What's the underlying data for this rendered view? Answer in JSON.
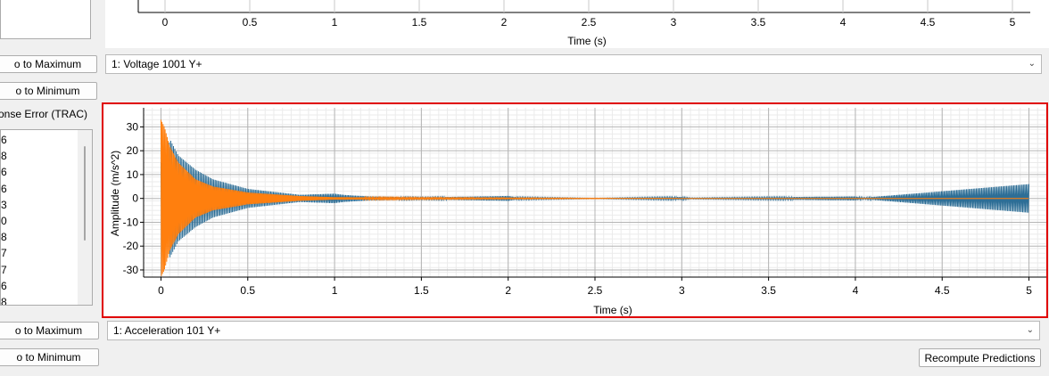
{
  "top_plot": {
    "xlabel": "Time (s)",
    "xticks": [
      "0",
      "0.5",
      "1",
      "1.5",
      "2",
      "2.5",
      "3",
      "3.5",
      "4",
      "4.5",
      "5"
    ]
  },
  "left_panel": {
    "go_max_1": "o to Maximum",
    "go_min_1": "o to Minimum",
    "response_error_label": "onse Error (TRAC)",
    "list_values": [
      "6",
      "8",
      "6",
      "6",
      "3",
      "0",
      "8",
      "7",
      "7",
      "6",
      "8"
    ],
    "go_max_2": "o to Maximum",
    "go_min_2": "o to Minimum"
  },
  "selectors": {
    "voltage": "1: Voltage 1001 Y+",
    "acceleration": "1: Acceleration 101 Y+"
  },
  "recompute_button": "Recompute Predictions",
  "chart_data": {
    "type": "line",
    "title": "",
    "xlabel": "Time (s)",
    "ylabel": "Amplitude (m/s^2)",
    "xlim": [
      -0.1,
      5.1
    ],
    "ylim": [
      -33,
      38
    ],
    "xticks": [
      0,
      0.5,
      1,
      1.5,
      2,
      2.5,
      3,
      3.5,
      4,
      4.5,
      5
    ],
    "xtick_labels": [
      "0",
      "0.5",
      "1",
      "1.5",
      "2",
      "2.5",
      "3",
      "3.5",
      "4",
      "4.5",
      "5"
    ],
    "yticks": [
      -30,
      -20,
      -10,
      0,
      10,
      20,
      30
    ],
    "ytick_labels": [
      "-30",
      "-20",
      "-10",
      "0",
      "10",
      "20",
      "30"
    ],
    "grid": true,
    "colors": {
      "measured": "#2d6e96",
      "predicted": "#ff7f0e",
      "highlight_border": "#e00000"
    },
    "series": [
      {
        "values_note": "measured",
        "x": [
          0,
          0.05,
          0.1,
          0.2,
          0.3,
          0.5,
          0.8,
          1.0,
          1.05,
          1.2,
          1.5,
          2.0,
          2.05,
          2.5,
          3.0,
          3.05,
          4.0,
          4.05,
          5.0
        ],
        "y": [
          -15,
          25,
          18,
          12,
          8,
          4,
          1.5,
          2,
          1.5,
          0.8,
          0.4,
          1,
          0.5,
          0.1,
          0.6,
          0.2,
          0.8,
          0.3,
          6
        ]
      },
      {
        "values_note": "predicted",
        "x": [
          0,
          0.02,
          0.05,
          0.1,
          0.2,
          0.3,
          0.5,
          0.8,
          1.0,
          1.5,
          2.0,
          2.5,
          3.0,
          4.0,
          5.0
        ],
        "y": [
          33,
          30,
          22,
          15,
          8,
          5,
          2.5,
          1,
          0.5,
          0.3,
          0.2,
          0.1,
          0.05,
          0.05,
          0.05
        ]
      }
    ]
  }
}
